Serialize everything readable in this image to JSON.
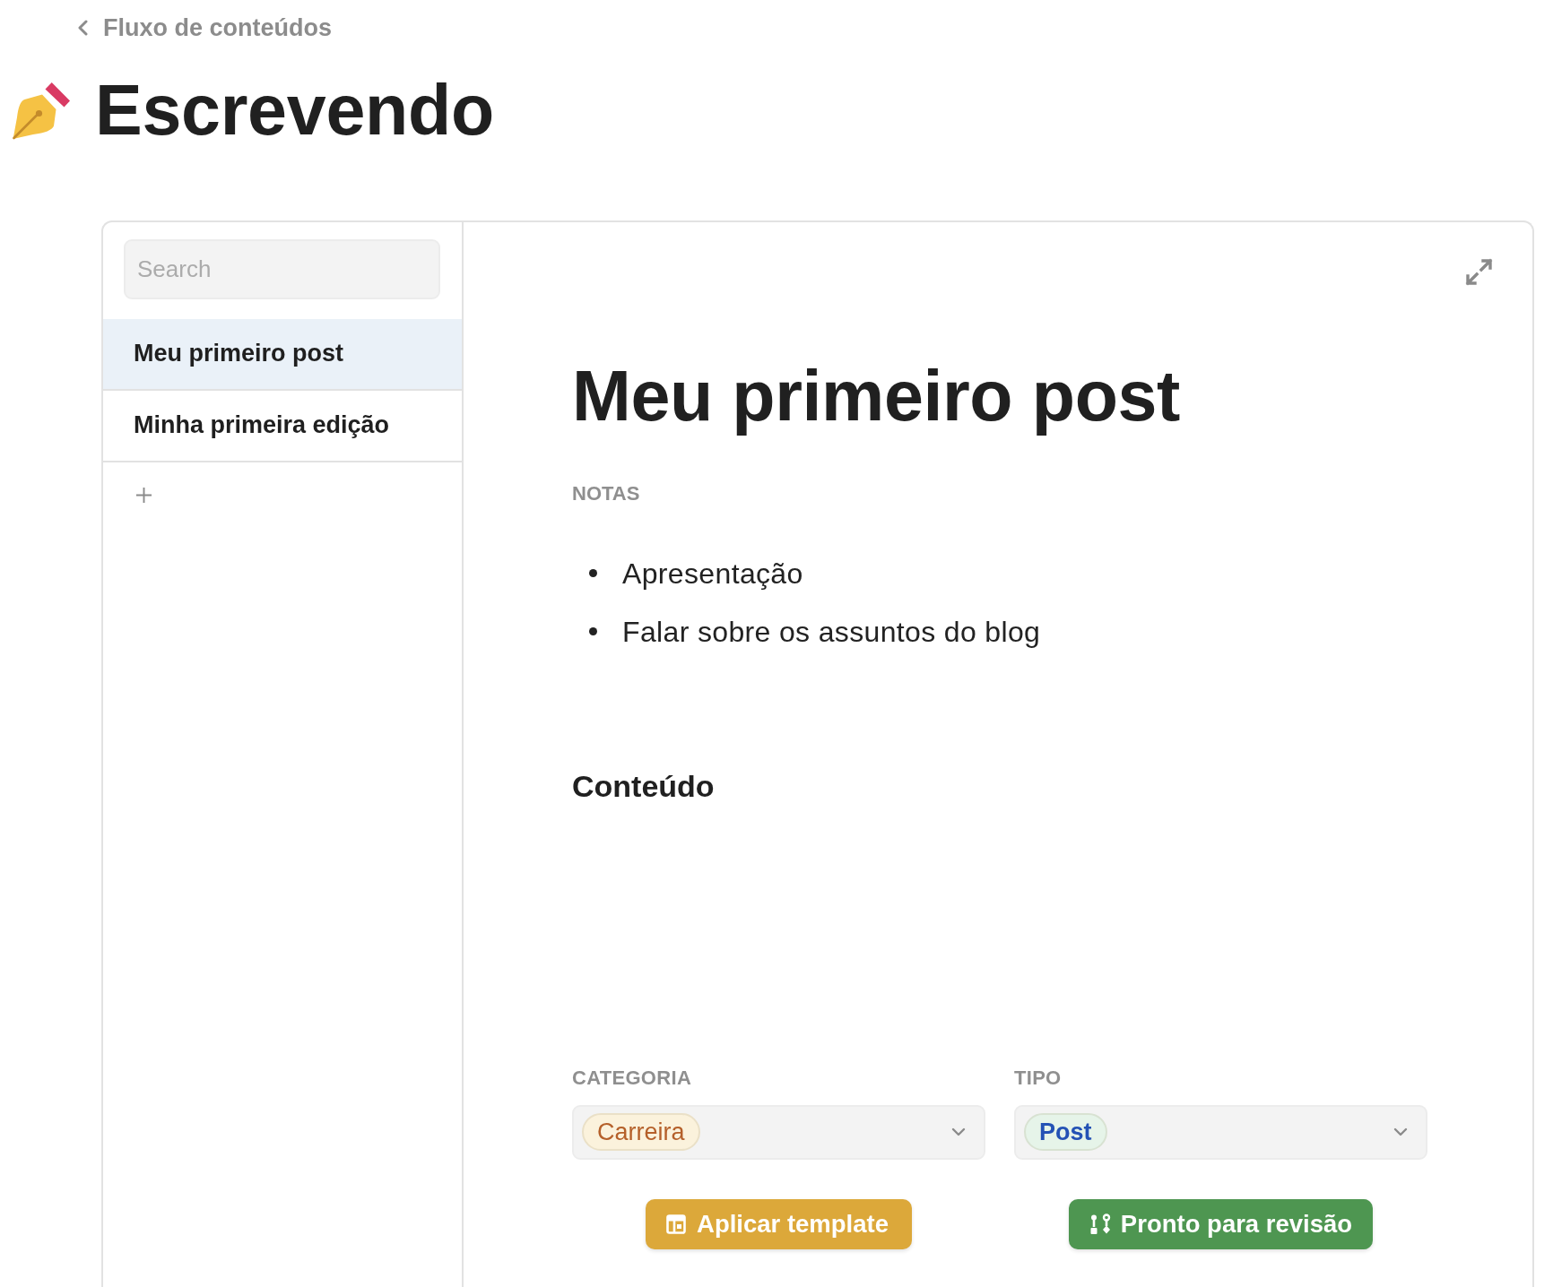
{
  "breadcrumb": {
    "label": "Fluxo de conteúdos"
  },
  "page": {
    "title": "Escrevendo"
  },
  "sidebar": {
    "search": {
      "placeholder": "Search"
    },
    "items": [
      {
        "label": "Meu primeiro post",
        "selected": true
      },
      {
        "label": "Minha primeira edição",
        "selected": false
      }
    ]
  },
  "document": {
    "title": "Meu primeiro post",
    "notes_label": "NOTAS",
    "notes": [
      "Apresentação",
      "Falar sobre os assuntos do blog"
    ],
    "content_heading": "Conteúdo",
    "fields": [
      {
        "kind": "category",
        "label": "CATEGORIA",
        "value": {
          "label": "Carreira",
          "color": "#fbf2dc"
        }
      },
      {
        "kind": "type",
        "label": "TIPO",
        "value": {
          "label": "Post",
          "color": "#e6f4e9"
        }
      }
    ],
    "buttons": [
      {
        "kind": "template",
        "label": "Aplicar template"
      },
      {
        "kind": "review",
        "label": "Pronto para revisão"
      }
    ]
  }
}
